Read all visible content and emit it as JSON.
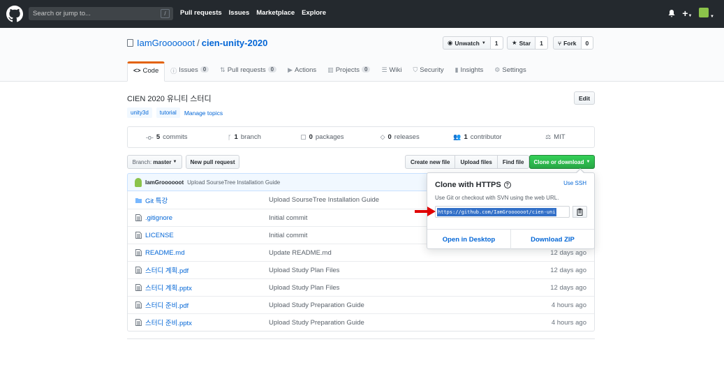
{
  "header": {
    "search_placeholder": "Search or jump to...",
    "search_key": "/",
    "nav": [
      "Pull requests",
      "Issues",
      "Marketplace",
      "Explore"
    ],
    "plus": "+"
  },
  "repo": {
    "owner": "IamGroooooot",
    "separator": "/",
    "name": "cien-unity-2020",
    "watch_label": "Unwatch",
    "watch_count": "1",
    "star_label": "Star",
    "star_count": "1",
    "fork_label": "Fork",
    "fork_count": "0"
  },
  "tabs": [
    {
      "label": "Code",
      "icon": "<>"
    },
    {
      "label": "Issues",
      "badge": "0",
      "icon": "ⓘ"
    },
    {
      "label": "Pull requests",
      "badge": "0",
      "icon": "⇅"
    },
    {
      "label": "Actions",
      "icon": "▶"
    },
    {
      "label": "Projects",
      "badge": "0",
      "icon": "▥"
    },
    {
      "label": "Wiki",
      "icon": "☰"
    },
    {
      "label": "Security",
      "icon": "⛉"
    },
    {
      "label": "Insights",
      "icon": "▮"
    },
    {
      "label": "Settings",
      "icon": "⚙"
    }
  ],
  "description": "CIEN 2020 유니티 스터디",
  "edit_label": "Edit",
  "topics": [
    "unity3d",
    "tutorial"
  ],
  "manage_topics": "Manage topics",
  "summary": {
    "commits_num": "5",
    "commits_label": "commits",
    "branch_num": "1",
    "branch_label": "branch",
    "packages_num": "0",
    "packages_label": "packages",
    "releases_num": "0",
    "releases_label": "releases",
    "contributors_num": "1",
    "contributors_label": "contributor",
    "license": "MIT"
  },
  "filenav": {
    "branch_prefix": "Branch:",
    "branch": "master",
    "new_pr": "New pull request",
    "create_file": "Create new file",
    "upload_files": "Upload files",
    "find_file": "Find file",
    "clone": "Clone or download"
  },
  "commit": {
    "author": "IamGroooooot",
    "message": "Upload SourseTree Installation Guide"
  },
  "files": [
    {
      "name": "Git 특강",
      "type": "folder",
      "message": "Upload SourseTree Installation Guide",
      "age": ""
    },
    {
      "name": ".gitignore",
      "type": "file",
      "message": "Initial commit",
      "age": ""
    },
    {
      "name": "LICENSE",
      "type": "file",
      "message": "Initial commit",
      "age": ""
    },
    {
      "name": "README.md",
      "type": "file",
      "message": "Update README.md",
      "age": "12 days ago"
    },
    {
      "name": "스터디 계획.pdf",
      "type": "file",
      "message": "Upload Study Plan Files",
      "age": "12 days ago"
    },
    {
      "name": "스터디 계획.pptx",
      "type": "file",
      "message": "Upload Study Plan Files",
      "age": "12 days ago"
    },
    {
      "name": "스터디 준비.pdf",
      "type": "file",
      "message": "Upload Study Preparation Guide",
      "age": "4 hours ago"
    },
    {
      "name": "스터디 준비.pptx",
      "type": "file",
      "message": "Upload Study Preparation Guide",
      "age": "4 hours ago"
    }
  ],
  "clone_popup": {
    "title": "Clone with HTTPS",
    "help_icon": "?",
    "use_ssh": "Use SSH",
    "help": "Use Git or checkout with SVN using the web URL.",
    "url": "https://github.com/IamGroooooot/cien-uni",
    "open_desktop": "Open in Desktop",
    "download_zip": "Download ZIP"
  },
  "colors": {
    "header_bg": "#24292e",
    "link": "#0366d6",
    "green": "#28a745",
    "tab_accent": "#e36209",
    "arrow": "#e00000"
  }
}
